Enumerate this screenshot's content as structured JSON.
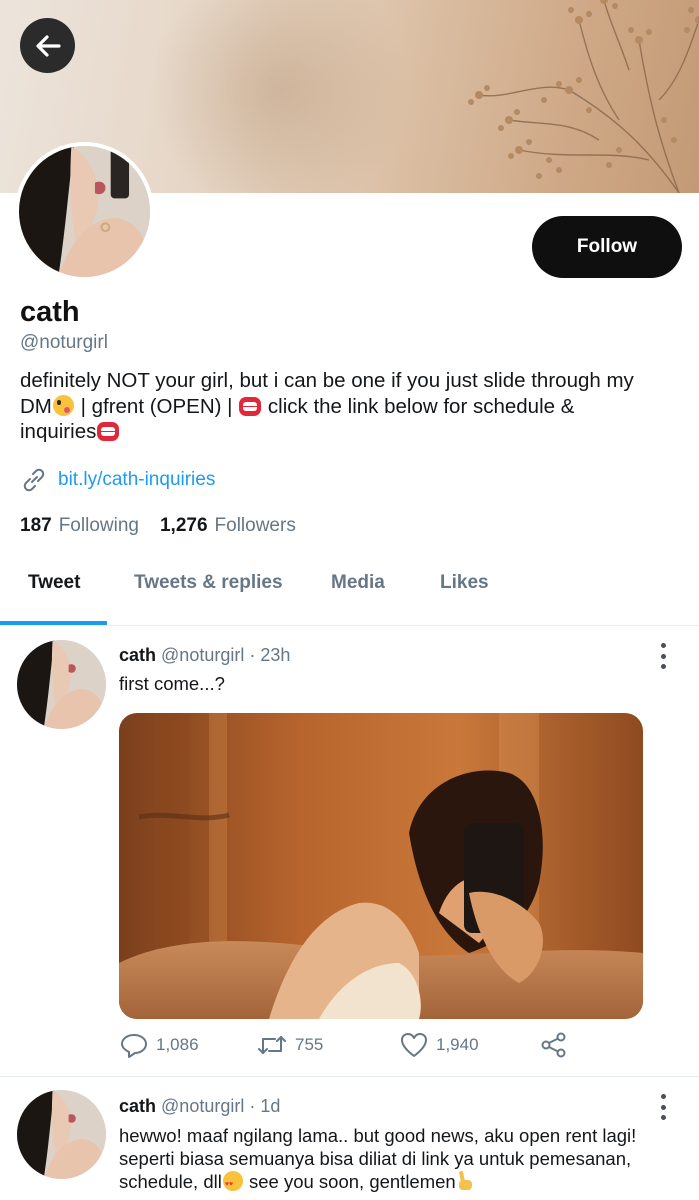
{
  "profile": {
    "name": "cath",
    "handle": "@noturgirl",
    "follow_label": "Follow",
    "bio_line1": "definitely NOT your girl, but i can be one if you just slide through my",
    "bio_line2_a": "DM",
    "bio_line2_b": " | gfrent (OPEN) | ",
    "bio_line2_c": " click the link below for schedule &",
    "bio_line3": "inquiries",
    "link": "bit.ly/cath-inquiries",
    "following_count": "187",
    "following_label": "Following",
    "followers_count": "1,276",
    "followers_label": "Followers"
  },
  "tabs": [
    {
      "label": "Tweet",
      "active": true
    },
    {
      "label": "Tweets & replies",
      "active": false
    },
    {
      "label": "Media",
      "active": false
    },
    {
      "label": "Likes",
      "active": false
    }
  ],
  "tweets": [
    {
      "name": "cath",
      "handle": "@noturgirl",
      "time": "23h",
      "text": "first come...?",
      "replies": "1,086",
      "retweets": "755",
      "likes": "1,940"
    },
    {
      "name": "cath",
      "handle": "@noturgirl",
      "time": "1d",
      "line1": "hewwo! maaf ngilang lama.. but good news, aku open rent lagi!",
      "line2": "seperti biasa semuanya bisa diliat di link ya untuk pemesanan,",
      "line3a": "schedule, dll",
      "line3b": " see you soon, gentlemen"
    }
  ],
  "icons": {
    "back": "arrow-left-icon",
    "link": "link-icon",
    "reply": "reply-icon",
    "retweet": "retweet-icon",
    "like": "heart-icon",
    "share": "share-icon",
    "more": "more-vertical-icon"
  },
  "colors": {
    "accent": "#1d9bf0",
    "secondary_text": "#657786",
    "button_bg": "#0f0f0f"
  }
}
